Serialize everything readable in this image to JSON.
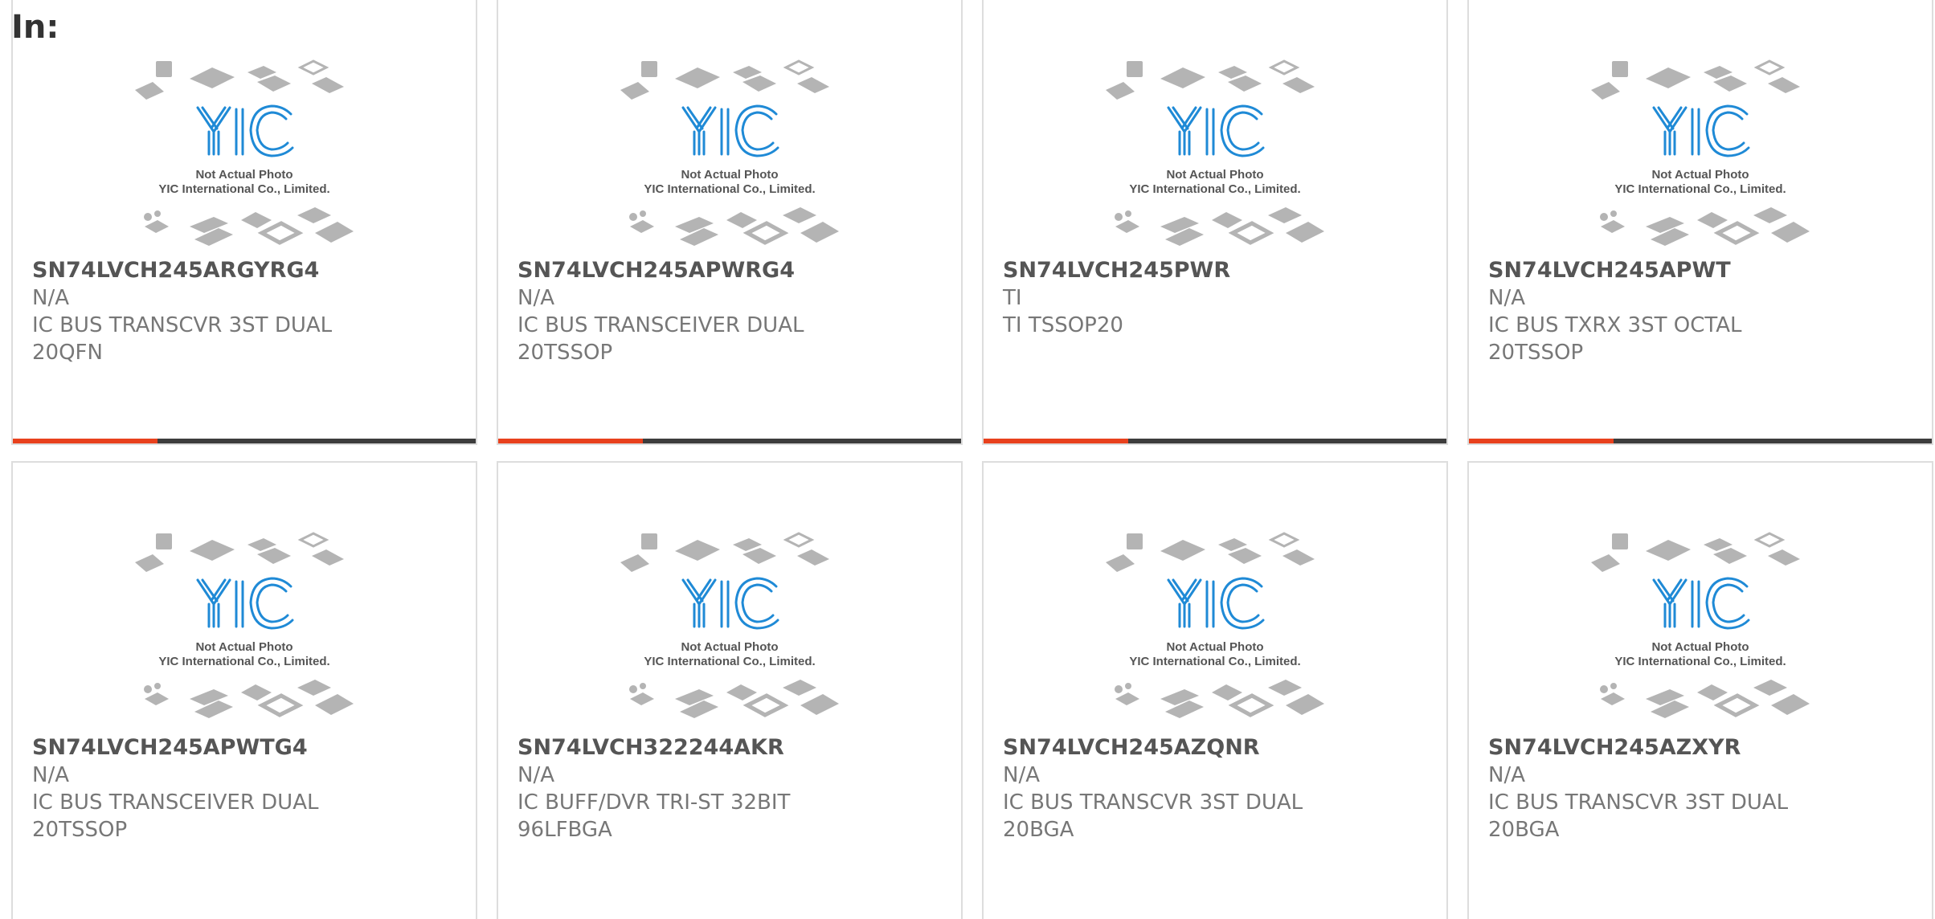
{
  "page": {
    "label": "In:"
  },
  "photo": {
    "caption_line_1": "Not Actual Photo",
    "caption_line_2": "YIC International Co., Limited.",
    "logo_text": "YIC"
  },
  "colors": {
    "accent": "#e8411d",
    "bar_dark": "#3d3d3d",
    "logo_blue": "#1f8ad6",
    "chip_gray": "#b4b4b4"
  },
  "products": [
    {
      "part_number": "SN74LVCH245ARGYRG4",
      "maker": "N/A",
      "description": "IC BUS TRANSCVR 3ST DUAL 20QFN"
    },
    {
      "part_number": "SN74LVCH245APWRG4",
      "maker": "N/A",
      "description": "IC BUS TRANSCEIVER DUAL 20TSSOP"
    },
    {
      "part_number": "SN74LVCH245PWR",
      "maker": "TI",
      "description": "TI TSSOP20"
    },
    {
      "part_number": "SN74LVCH245APWT",
      "maker": "N/A",
      "description": "IC BUS TXRX 3ST OCTAL 20TSSOP"
    },
    {
      "part_number": "SN74LVCH245APWTG4",
      "maker": "N/A",
      "description": "IC BUS TRANSCEIVER DUAL 20TSSOP"
    },
    {
      "part_number": "SN74LVCH322244AKR",
      "maker": "N/A",
      "description": "IC BUFF/DVR TRI-ST 32BIT 96LFBGA"
    },
    {
      "part_number": "SN74LVCH245AZQNR",
      "maker": "N/A",
      "description": "IC BUS TRANSCVR 3ST DUAL 20BGA"
    },
    {
      "part_number": "SN74LVCH245AZXYR",
      "maker": "N/A",
      "description": "IC BUS TRANSCVR 3ST DUAL 20BGA"
    }
  ]
}
